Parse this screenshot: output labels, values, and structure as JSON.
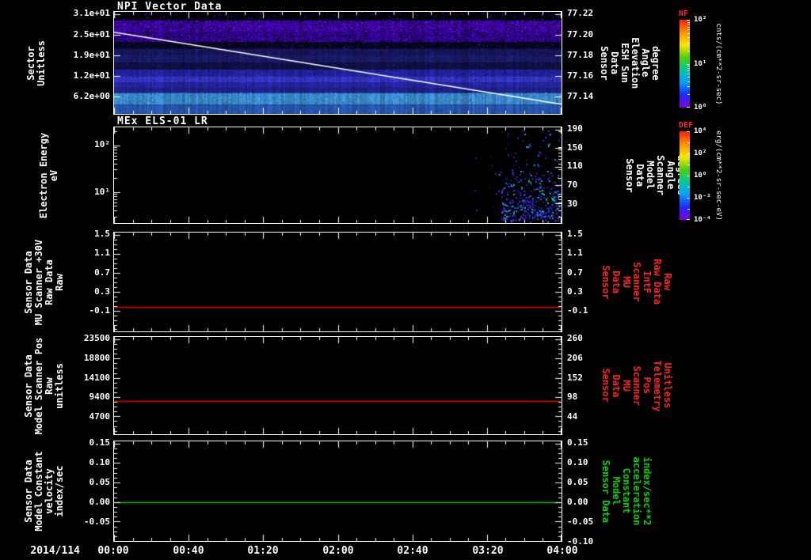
{
  "chart_data": {
    "type": "multi-panel-timeseries",
    "time_axis": {
      "prefix_label": "2014/114",
      "tick_labels": [
        "00:00",
        "00:40",
        "01:20",
        "02:00",
        "02:40",
        "03:20",
        "04:00"
      ],
      "x_range": [
        "2014/114 00:00",
        "2014/114 04:00"
      ]
    },
    "colorbars": [
      {
        "title": "NF",
        "unit": "cnts/(cm**2-sr-sec)",
        "tick_labels": [
          "10²",
          "10¹",
          "10⁰"
        ],
        "tick_fracs": [
          0,
          0.5,
          1
        ],
        "minor_fracs": [
          0.023,
          0.048,
          0.077,
          0.111,
          0.151,
          0.199,
          0.261,
          0.349,
          0.523,
          0.548,
          0.577,
          0.611,
          0.651,
          0.699,
          0.761,
          0.849
        ],
        "gradient": [
          "#ff1e00",
          "#ff9100",
          "#ffe600",
          "#50d200",
          "#00c8a0",
          "#00a0ff",
          "#1e28ff",
          "#8200dc"
        ]
      },
      {
        "title": "DEF",
        "unit": "erg/(cm**2-sr-sec-eV)",
        "tick_labels": [
          "10⁴",
          "10²",
          "10⁰",
          "10⁻²",
          "10⁻⁴"
        ],
        "tick_fracs": [
          0,
          0.25,
          0.5,
          0.75,
          1
        ],
        "minor_fracs": [
          0.125,
          0.375,
          0.625,
          0.875
        ],
        "gradient": [
          "#ff1e00",
          "#ff9100",
          "#ffe600",
          "#50d200",
          "#00c8a0",
          "#00a0ff",
          "#1e28ff",
          "#8200dc"
        ]
      }
    ],
    "panels": [
      {
        "name": "npi-vector-data",
        "type": "heatmap",
        "title": "NPI Vector Data",
        "ylabel": "Sector\nUnitless",
        "ylim": [
          0.8,
          31.8
        ],
        "yticks": {
          "labels": [
            "3.1e+01",
            "2.5e+01",
            "1.9e+01",
            "1.2e+01",
            "6.2e+00"
          ],
          "values": [
            31,
            24.8,
            18.6,
            12.4,
            6.2
          ],
          "fracs": [
            0.026,
            0.226,
            0.426,
            0.626,
            0.826
          ]
        },
        "right_label": "Sensor Data\nESH Sun Elevation\nAngle\ndegree",
        "right_label_color": "#ffffff",
        "right_ticks": {
          "labels": [
            "77.22",
            "77.20",
            "77.18",
            "77.16",
            "77.14"
          ],
          "values": [
            77.22,
            77.2,
            77.18,
            77.16,
            77.14
          ],
          "fracs": [
            0.026,
            0.226,
            0.426,
            0.626,
            0.826
          ]
        },
        "colorbar": "NF",
        "y_minor_fracs": [],
        "bands": [
          {
            "y0": 0.0,
            "y1": 0.084,
            "base": "#03000a",
            "speckle": "#5a14d2",
            "d1": 0.05
          },
          {
            "y0": 0.084,
            "y1": 0.2,
            "base": "#4b00c8",
            "speckle": "#0e0028",
            "d1": 0.45,
            "speckle2": "#8232f0",
            "d2": 0.1
          },
          {
            "y0": 0.2,
            "y1": 0.295,
            "base": "#3e00b4",
            "speckle": "#0a001e",
            "d1": 0.5,
            "speckle2": "#6e1ee6",
            "d2": 0.08
          },
          {
            "y0": 0.295,
            "y1": 0.36,
            "base": "#07071e",
            "speckle": "#2a148c",
            "d1": 0.12
          },
          {
            "y0": 0.36,
            "y1": 0.415,
            "base": "#17175e",
            "speckle": "#232390",
            "d1": 0.3
          },
          {
            "y0": 0.415,
            "y1": 0.5,
            "base": "#1e1e78",
            "speckle": "#14144b",
            "d1": 0.3
          },
          {
            "y0": 0.5,
            "y1": 0.565,
            "base": "#101046",
            "speckle": "#1e1e6e",
            "d1": 0.25
          },
          {
            "y0": 0.565,
            "y1": 0.63,
            "base": "#2828b4",
            "speckle": "#1a1a78",
            "d1": 0.3
          },
          {
            "y0": 0.63,
            "y1": 0.695,
            "base": "#3c3ce1",
            "speckle": "#28289b",
            "d1": 0.25
          },
          {
            "y0": 0.695,
            "y1": 0.745,
            "base": "#2a2ab9",
            "speckle": "#1e1e8c",
            "d1": 0.25
          },
          {
            "y0": 0.745,
            "y1": 0.795,
            "base": "#232396",
            "speckle": "#2e2eb4",
            "d1": 0.25
          },
          {
            "y0": 0.795,
            "y1": 0.91,
            "base": "#419be6",
            "speckle": "#2d7dc8",
            "d1": 0.3,
            "speckle2": "#78c8ff",
            "d2": 0.12
          },
          {
            "y0": 0.91,
            "y1": 1.0,
            "base": "#2d64c8",
            "speckle": "#2050a0",
            "d1": 0.3
          }
        ],
        "overlay_line": {
          "series_name": "ESH Sun Elevation Angle",
          "color": "#ffffff",
          "from_frac": [
            0,
            0.2
          ],
          "to_frac": [
            1,
            0.905
          ],
          "value_start": 77.21,
          "value_end": 77.135
        }
      },
      {
        "name": "mex-els-01-lr",
        "type": "heatmap",
        "title": "MEx ELS-01 LR",
        "ylabel": "Electron Energy\neV",
        "ylim_ev": [
          2,
          250
        ],
        "yticks": {
          "labels": [
            "10²",
            "10¹"
          ],
          "values": [
            100,
            10
          ],
          "fracs": [
            0.187,
            0.675
          ]
        },
        "right_label": "Sensor Data\nModel Scanner\nAngle\ndegrees",
        "right_label_color": "#ffffff",
        "right_ticks": {
          "labels": [
            "190",
            "150",
            "110",
            "70",
            "30"
          ],
          "values": [
            190,
            150,
            110,
            70,
            30
          ],
          "fracs": [
            0.024,
            0.217,
            0.41,
            0.603,
            0.797
          ]
        },
        "colorbar": "DEF",
        "y_minor_fracs": [
          0.04,
          0.209,
          0.234,
          0.263,
          0.295,
          0.334,
          0.381,
          0.442,
          0.528,
          0.697,
          0.722,
          0.751,
          0.783,
          0.822,
          0.869,
          0.93
        ],
        "scatter": {
          "colors": [
            "#281eb4",
            "#3c28dc",
            "#5214c8",
            "#1e50f0",
            "#00a0e6",
            "#00c86e"
          ],
          "clusters": [
            {
              "count": 380,
              "x0": 0.865,
              "x1": 0.995,
              "y0": 0.45,
              "y1": 0.985,
              "bias": "bottom"
            },
            {
              "count": 150,
              "x0": 0.875,
              "x1": 0.995,
              "y0": 0.03,
              "y1": 0.95
            },
            {
              "count": 12,
              "x0": 0.8,
              "x1": 0.865,
              "y0": 0.25,
              "y1": 0.9
            }
          ]
        }
      },
      {
        "name": "mu-scanner-30v-raw",
        "type": "line",
        "ylabel": "Sensor Data\nMU Scanner +30V\nRaw Data\nRaw",
        "ylim": [
          -0.55,
          1.55
        ],
        "yticks": {
          "labels": [
            "1.5",
            "1.1",
            "0.7",
            "0.3",
            "-0.1"
          ],
          "values": [
            1.5,
            1.1,
            0.7,
            0.3,
            -0.1
          ],
          "fracs": [
            0.024,
            0.215,
            0.406,
            0.597,
            0.788
          ]
        },
        "right_label": "Sensor Data\nMU Scanner IntF\nRaw Data\nRaw",
        "right_label_color": "#ff2020",
        "right_ticks": {
          "labels": [
            "1.5",
            "1.1",
            "0.7",
            "0.3",
            "-0.1"
          ],
          "values": [
            1.5,
            1.1,
            0.7,
            0.3,
            -0.1
          ],
          "fracs": [
            0.024,
            0.215,
            0.406,
            0.597,
            0.788
          ]
        },
        "y_minor_fracs": [
          0.072,
          0.12,
          0.167,
          0.263,
          0.311,
          0.358,
          0.454,
          0.502,
          0.549,
          0.645,
          0.693,
          0.74,
          0.836,
          0.884,
          0.932,
          0.979
        ],
        "series": [
          {
            "name": "MU Scanner +30V Raw Data",
            "color": "#e80000",
            "value": 0.0,
            "frac": 0.748
          }
        ]
      },
      {
        "name": "model-scanner-pos-raw",
        "type": "line",
        "ylabel": "Sensor Data\nModel Scanner Pos\nRaw\nunitless",
        "ylim": [
          330,
          24070
        ],
        "yticks": {
          "labels": [
            "23500",
            "18800",
            "14100",
            "9400",
            "4700"
          ],
          "values": [
            23500,
            18800,
            14100,
            9400,
            4700
          ],
          "fracs": [
            0.024,
            0.222,
            0.42,
            0.618,
            0.816
          ]
        },
        "right_label": "Sensor Data\nMU Scanner Pos\nTelemetry\nUnitless",
        "right_label_color": "#ff2020",
        "right_ticks": {
          "labels": [
            "260",
            "206",
            "152",
            "98",
            "44"
          ],
          "values": [
            260,
            206,
            152,
            98,
            44
          ],
          "fracs": [
            0.024,
            0.222,
            0.42,
            0.618,
            0.816
          ]
        },
        "y_minor_fracs": [
          0.074,
          0.123,
          0.173,
          0.272,
          0.321,
          0.371,
          0.47,
          0.519,
          0.569,
          0.667,
          0.717,
          0.766,
          0.865,
          0.915,
          0.964
        ],
        "series": [
          {
            "name": "Model Scanner Pos Raw",
            "color": "#e80000",
            "value": 8500,
            "right_axis_value": 88,
            "frac": 0.656
          }
        ]
      },
      {
        "name": "model-constant-velocity",
        "type": "line",
        "ylabel": "Sensor Data\nModel Constant\nvelocity\nindex/sec",
        "ylim": [
          -0.1,
          0.156
        ],
        "yticks": {
          "labels": [
            "0.15",
            "0.10",
            "0.05",
            "0.00",
            "-0.05"
          ],
          "values": [
            0.15,
            0.1,
            0.05,
            0.0,
            -0.05
          ],
          "fracs": [
            0.023,
            0.218,
            0.414,
            0.609,
            0.805
          ]
        },
        "right_label": "Sensor Data\nModel Constant\nacceleration\nindex/sec**2",
        "right_label_color": "#00d200",
        "right_ticks": {
          "labels": [
            "0.15",
            "0.10",
            "0.05",
            "0.00",
            "-0.05",
            "-0.10"
          ],
          "values": [
            0.15,
            0.1,
            0.05,
            0.0,
            -0.05,
            -0.1
          ],
          "fracs": [
            0.023,
            0.218,
            0.414,
            0.609,
            0.805,
            1.0
          ]
        },
        "y_minor_fracs": [
          0.072,
          0.121,
          0.17,
          0.267,
          0.316,
          0.365,
          0.463,
          0.512,
          0.561,
          0.658,
          0.707,
          0.756,
          0.854,
          0.903,
          0.952
        ],
        "series": [
          {
            "name": "Model Constant velocity",
            "color": "#00c800",
            "value": 0.0,
            "frac": 0.609
          }
        ]
      }
    ]
  }
}
